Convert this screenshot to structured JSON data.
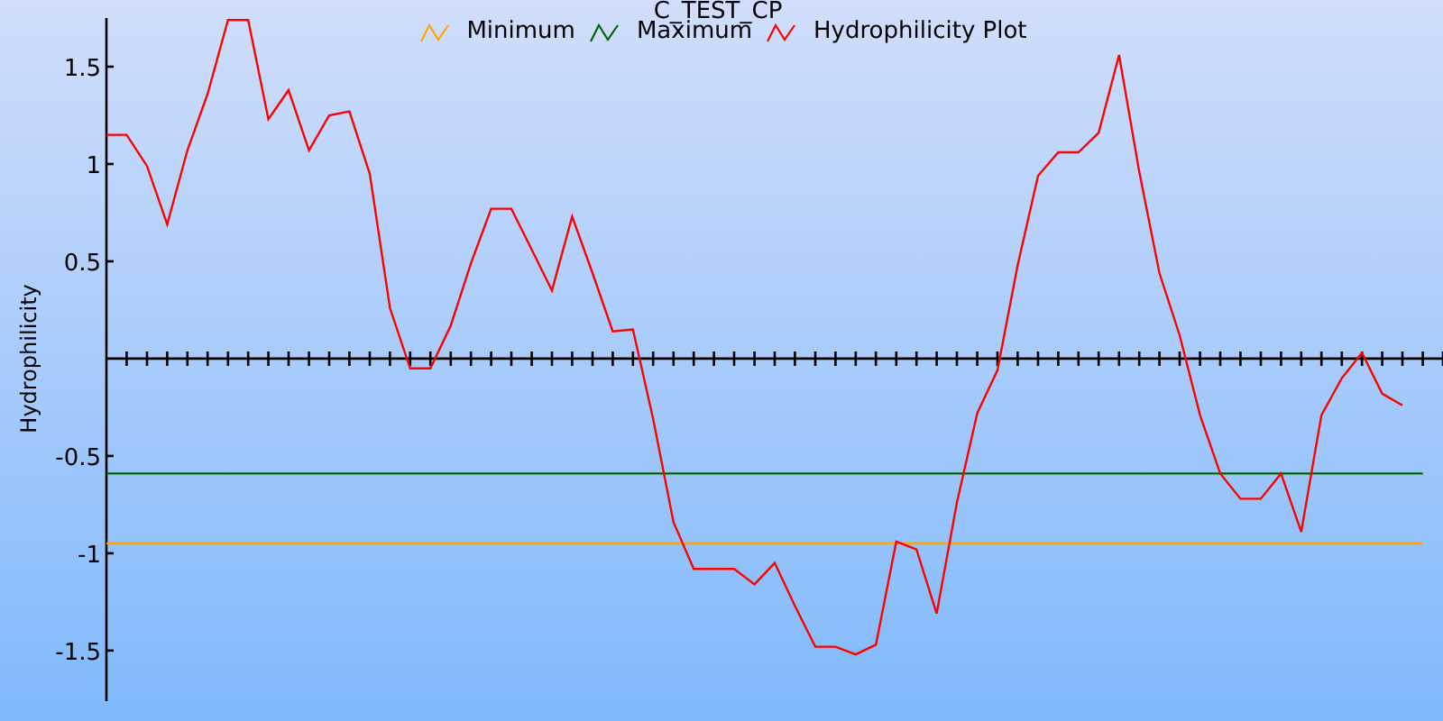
{
  "chart": {
    "chart_data": {
      "type": "line",
      "title": "C_TEST_CP",
      "ylabel": "Hydrophilicity",
      "ylim": [
        -1.76,
        1.75
      ],
      "yticks": [
        -1.5,
        -1,
        -0.5,
        0.5,
        1,
        1.5
      ],
      "series": [
        {
          "name": "Minimum",
          "color": "#ffa500",
          "values": [
            -0.95,
            -0.95,
            -0.95,
            -0.95,
            -0.95,
            -0.95,
            -0.95,
            -0.95,
            -0.95,
            -0.95,
            -0.95,
            -0.95,
            -0.95,
            -0.95,
            -0.95,
            -0.95,
            -0.95,
            -0.95,
            -0.95,
            -0.95,
            -0.95,
            -0.95,
            -0.95,
            -0.95,
            -0.95,
            -0.95,
            -0.95,
            -0.95,
            -0.95,
            -0.95,
            -0.95,
            -0.95,
            -0.95,
            -0.95,
            -0.95,
            -0.95,
            -0.95,
            -0.95,
            -0.95,
            -0.95,
            -0.95,
            -0.95,
            -0.95,
            -0.95,
            -0.95,
            -0.95,
            -0.95,
            -0.95,
            -0.95,
            -0.95,
            -0.95,
            -0.95,
            -0.95,
            -0.95,
            -0.95,
            -0.95,
            -0.95,
            -0.95,
            -0.95,
            -0.95,
            -0.95,
            -0.95,
            -0.95,
            -0.95,
            -0.95,
            -0.95
          ]
        },
        {
          "name": "Maximum",
          "color": "#006400",
          "values": [
            -0.59,
            -0.59,
            -0.59,
            -0.59,
            -0.59,
            -0.59,
            -0.59,
            -0.59,
            -0.59,
            -0.59,
            -0.59,
            -0.59,
            -0.59,
            -0.59,
            -0.59,
            -0.59,
            -0.59,
            -0.59,
            -0.59,
            -0.59,
            -0.59,
            -0.59,
            -0.59,
            -0.59,
            -0.59,
            -0.59,
            -0.59,
            -0.59,
            -0.59,
            -0.59,
            -0.59,
            -0.59,
            -0.59,
            -0.59,
            -0.59,
            -0.59,
            -0.59,
            -0.59,
            -0.59,
            -0.59,
            -0.59,
            -0.59,
            -0.59,
            -0.59,
            -0.59,
            -0.59,
            -0.59,
            -0.59,
            -0.59,
            -0.59,
            -0.59,
            -0.59,
            -0.59,
            -0.59,
            -0.59,
            -0.59,
            -0.59,
            -0.59,
            -0.59,
            -0.59,
            -0.59,
            -0.59,
            -0.59,
            -0.59,
            -0.59,
            -0.59
          ]
        },
        {
          "name": "Hydrophilicity Plot",
          "color": "#ff0000",
          "values": [
            1.15,
            1.15,
            0.99,
            0.69,
            1.07,
            1.36,
            1.74,
            1.74,
            1.23,
            1.38,
            1.07,
            1.25,
            1.27,
            0.95,
            0.26,
            -0.05,
            -0.05,
            0.17,
            0.49,
            0.77,
            0.77,
            0.56,
            0.35,
            0.73,
            0.44,
            0.14,
            0.15,
            -0.31,
            -0.84,
            -1.08,
            -1.08,
            -1.08,
            -1.16,
            -1.05,
            -1.27,
            -1.48,
            -1.48,
            -1.52,
            -1.47,
            -0.94,
            -0.98,
            -1.31,
            -0.74,
            -0.28,
            -0.06,
            0.48,
            0.94,
            1.06,
            1.06,
            1.16,
            1.56,
            0.96,
            0.44,
            0.12,
            -0.29,
            -0.59,
            -0.72,
            -0.72,
            -0.59,
            -0.89,
            -0.29,
            -0.1,
            0.03,
            -0.18,
            -0.24
          ]
        }
      ]
    }
  }
}
